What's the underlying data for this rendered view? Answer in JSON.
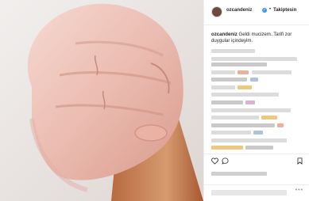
{
  "post": {
    "username": "ozcandeniz",
    "follow_status": "Takiptesin",
    "separator": "•",
    "caption_user": "ozcandeniz",
    "caption_text": "Geldi mucizem..Tarifi zor duygular içindeyim.",
    "verified_mark": "✓",
    "more_options": "•••"
  },
  "colors": {
    "verified": "#3897f0",
    "border": "#efefef",
    "text": "#262626"
  },
  "icons": [
    "avatar",
    "verified-badge-icon",
    "heart-icon",
    "comment-icon",
    "bookmark-icon",
    "more-icon"
  ]
}
